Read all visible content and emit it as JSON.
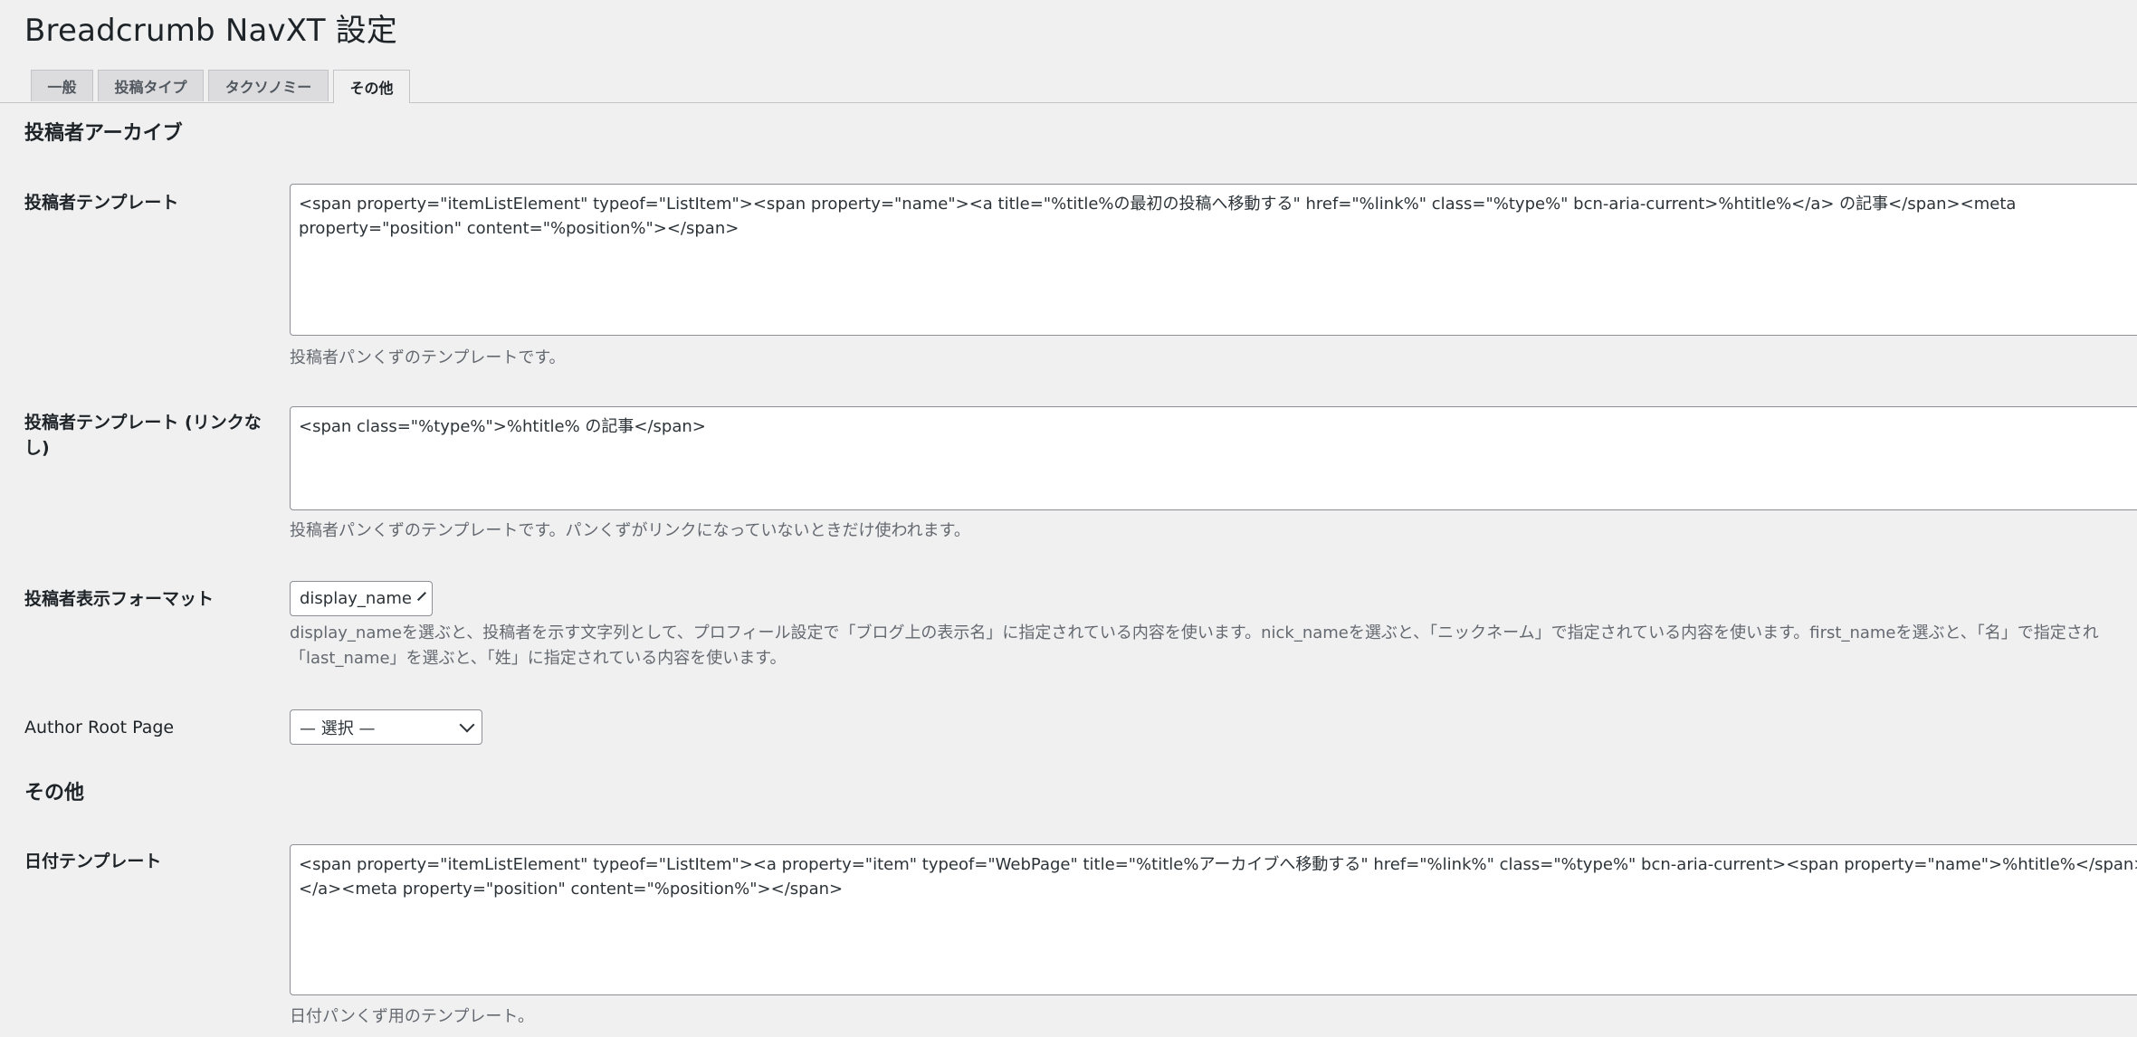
{
  "page": {
    "title": "Breadcrumb NavXT 設定"
  },
  "tabs": [
    "一般",
    "投稿タイプ",
    "タクソノミー",
    "その他"
  ],
  "author_archive": {
    "heading": "投稿者アーカイブ",
    "template": {
      "label": "投稿者テンプレート",
      "value": "<span property=\"itemListElement\" typeof=\"ListItem\"><span property=\"name\"><a title=\"%title%の最初の投稿へ移動する\" href=\"%link%\" class=\"%type%\" bcn-aria-current>%htitle%</a> の記事</span><meta property=\"position\" content=\"%position%\"></span>",
      "description": "投稿者パンくずのテンプレートです。"
    },
    "template_unlinked": {
      "label": "投稿者テンプレート (リンクなし)",
      "value": "<span class=\"%type%\">%htitle% の記事</span>",
      "description": "投稿者パンくずのテンプレートです。パンくずがリンクになっていないときだけ使われます。"
    },
    "display_format": {
      "label": "投稿者表示フォーマット",
      "value": "display_name",
      "description": "display_nameを選ぶと、投稿者を示す文字列として、プロフィール設定で「ブログ上の表示名」に指定されている内容を使います。nick_nameを選ぶと、「ニックネーム」で指定されている内容を使います。first_nameを選ぶと、「名」で指定され 「last_name」を選ぶと、「姓」に指定されている内容を使います。"
    },
    "root_page": {
      "label": "Author Root Page",
      "value": "— 選択 —"
    }
  },
  "misc": {
    "heading": "その他",
    "date_template": {
      "label": "日付テンプレート",
      "value": "<span property=\"itemListElement\" typeof=\"ListItem\"><a property=\"item\" typeof=\"WebPage\" title=\"%title%アーカイブへ移動する\" href=\"%link%\" class=\"%type%\" bcn-aria-current><span property=\"name\">%htitle%</span></a><meta property=\"position\" content=\"%position%\"></span>",
      "description": "日付パンくず用のテンプレート。"
    }
  }
}
